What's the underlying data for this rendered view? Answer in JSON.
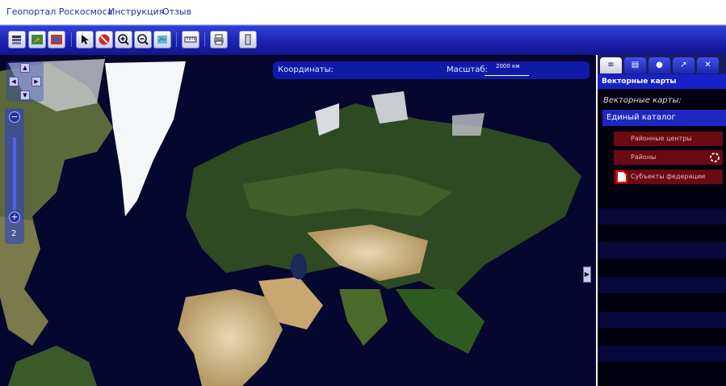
{
  "topnav": {
    "links": [
      "Геопортал Роскосмоса",
      "Инструкция",
      "Отзыв"
    ]
  },
  "toolbar": {
    "buttons": [
      "layers-icon",
      "map-edit-icon",
      "map-image-icon",
      "pointer-icon",
      "no-entry-icon",
      "zoom-in-icon",
      "zoom-out-icon",
      "full-extent-icon",
      "ruler-icon",
      "print-icon",
      "panel-icon"
    ]
  },
  "map": {
    "coordinates_label": "Координаты:",
    "scale_label": "Масштаб:",
    "scale_value": "2000 км",
    "zoom_level": "2",
    "zoom_in": "+",
    "zoom_out": "−",
    "nav": {
      "up": "▲",
      "down": "▼",
      "left": "◀",
      "right": "▶"
    }
  },
  "panel": {
    "tabs": [
      "layers-icon",
      "document-icon",
      "circle-icon",
      "tools-icon",
      "wrench-icon"
    ],
    "header": "Векторные карты",
    "subtitle": "Векторные карты:",
    "catalog": "Единый каталог",
    "layers": [
      "Районные центры",
      "Районы",
      "Субъекты федерации"
    ]
  },
  "colors": {
    "toolbar": "#1a20b0",
    "panel_header": "#1820c8",
    "layer_bg": "#6a0a14",
    "map_ocean": "#07083a"
  }
}
